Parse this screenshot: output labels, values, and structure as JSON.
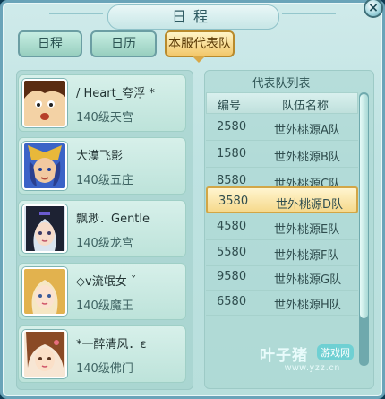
{
  "window": {
    "title": "日程",
    "close_label": "×"
  },
  "tabs": [
    {
      "label": "日程"
    },
    {
      "label": "日历"
    },
    {
      "label": "本服代表队"
    }
  ],
  "members": [
    {
      "name": "/ Heart_夸浮 *",
      "level": "140级天宫",
      "avatar": "boy-avatar"
    },
    {
      "name": "大漠飞影",
      "level": "140级五庄",
      "avatar": "warrior-avatar"
    },
    {
      "name": "飘渺．Gentle",
      "level": "140级龙宫",
      "avatar": "maiden-avatar"
    },
    {
      "name": "◇v流氓女 ˇ",
      "level": "140级魔王",
      "avatar": "blonde-avatar"
    },
    {
      "name": "*一醉清风．ε",
      "level": "140级佛门",
      "avatar": "girl-avatar"
    }
  ],
  "team_list": {
    "title": "代表队列表",
    "headers": [
      "编号",
      "队伍名称"
    ],
    "rows": [
      {
        "code": "2580",
        "team": "世外桃源A队"
      },
      {
        "code": "1580",
        "team": "世外桃源B队"
      },
      {
        "code": "8580",
        "team": "世外桃源C队"
      },
      {
        "code": "3580",
        "team": "世外桃源D队",
        "selected": true
      },
      {
        "code": "4580",
        "team": "世外桃源E队"
      },
      {
        "code": "5580",
        "team": "世外桃源F队"
      },
      {
        "code": "9580",
        "team": "世外桃源G队"
      },
      {
        "code": "6580",
        "team": "世外桃源H队"
      }
    ]
  },
  "watermark": {
    "brand": "叶子猪",
    "badge": "游戏网",
    "url": "www.yzz.cn"
  }
}
